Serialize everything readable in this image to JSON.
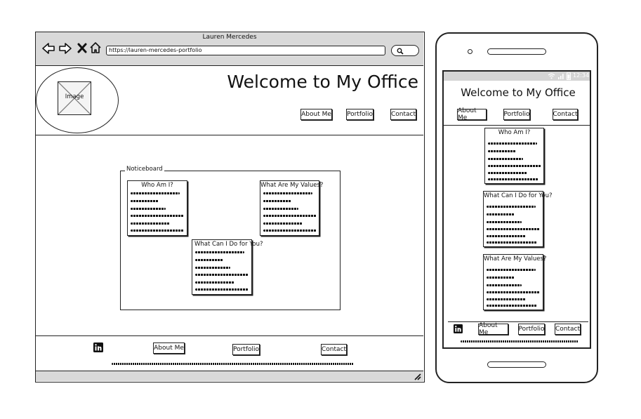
{
  "browser": {
    "title": "Lauren Mercedes",
    "url": "https://lauren-mercedes-portfolio"
  },
  "desktop": {
    "image_label": "Image",
    "heading": "Welcome to My Office",
    "nav": [
      "About Me",
      "Portfolio",
      "Contact"
    ],
    "noticeboard_label": "Noticeboard",
    "cards": [
      "Who Am I?",
      "What Are My Values?",
      "What Can I Do for You?"
    ],
    "footer_nav": [
      "About Me",
      "Portfolio",
      "Contact"
    ]
  },
  "mobile": {
    "status_time": "12:34",
    "heading": "Welcome to My Office",
    "nav": [
      "About Me",
      "Portfolio",
      "Contact"
    ],
    "cards": [
      "Who Am I?",
      "What Can I Do for You?",
      "What Are My Values?"
    ],
    "footer_nav": [
      "About Me",
      "Portfolio",
      "Contact"
    ]
  },
  "icons": {
    "back": "arrow-left-icon",
    "forward": "arrow-right-icon",
    "close": "close-icon",
    "home": "home-icon",
    "search": "search-icon",
    "social": "linkedin-icon"
  }
}
